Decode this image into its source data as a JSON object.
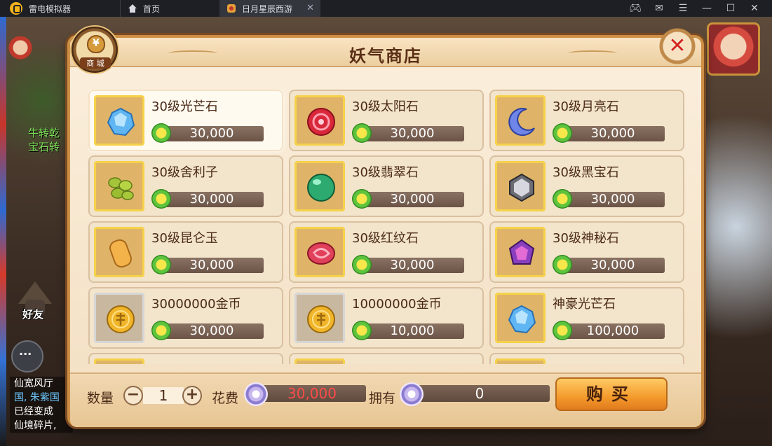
{
  "window": {
    "app_name": "雷电模拟器",
    "tabs": [
      {
        "label": "首页"
      },
      {
        "label": "日月星辰西游"
      }
    ]
  },
  "game": {
    "left_text_1": "牛转乾",
    "left_text_2": "宝石转",
    "friend_label": "好友",
    "chat_lines": [
      "仙宽风厅",
      "国, 朱紫国",
      "已经变成",
      "仙境碎片,"
    ]
  },
  "shop": {
    "title": "妖气商店",
    "badge_label": "商 城",
    "close_symbol": "✕",
    "items": [
      {
        "name": "30级光芒石",
        "price": "30,000",
        "icon": "blue-crystal-icon"
      },
      {
        "name": "30级太阳石",
        "price": "30,000",
        "icon": "red-sun-stone-icon"
      },
      {
        "name": "30级月亮石",
        "price": "30,000",
        "icon": "moon-stone-icon"
      },
      {
        "name": "30级舍利子",
        "price": "30,000",
        "icon": "sarira-icon"
      },
      {
        "name": "30级翡翠石",
        "price": "30,000",
        "icon": "emerald-orb-icon"
      },
      {
        "name": "30级黑宝石",
        "price": "30,000",
        "icon": "black-gem-icon"
      },
      {
        "name": "30级昆仑玉",
        "price": "30,000",
        "icon": "jade-pebble-icon"
      },
      {
        "name": "30级红纹石",
        "price": "30,000",
        "icon": "red-pattern-stone-icon"
      },
      {
        "name": "30级神秘石",
        "price": "30,000",
        "icon": "mystic-stone-icon"
      },
      {
        "name": "30000000金币",
        "price": "30,000",
        "icon": "gold-coin-icon"
      },
      {
        "name": "10000000金币",
        "price": "10,000",
        "icon": "gold-coin-icon"
      },
      {
        "name": "神豪光芒石",
        "price": "100,000",
        "icon": "blue-crystal-icon"
      }
    ],
    "footer": {
      "quantity_label": "数量",
      "quantity_value": "1",
      "minus_symbol": "−",
      "plus_symbol": "+",
      "cost_label": "花费",
      "cost_value": "30,000",
      "own_label": "拥有",
      "own_value": "0",
      "buy_label": "购买"
    }
  }
}
